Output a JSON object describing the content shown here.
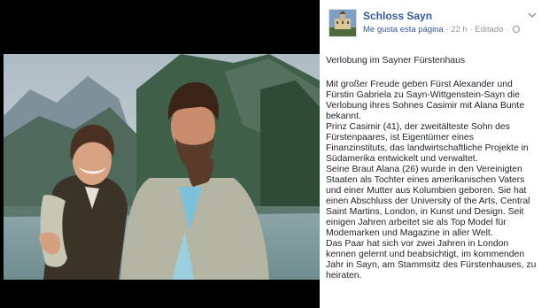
{
  "page": {
    "name": "Schloss Sayn",
    "like_label": "Me gusta esta página",
    "separator": "·",
    "time": "22 h",
    "edited": "Editado"
  },
  "post": {
    "title": "Verlobung im Sayner Fürstenhaus",
    "lines": [
      "Mit großer Freude geben Fürst Alexander und",
      "Fürstin Gabriela zu Sayn-Wittgenstein-Sayn die",
      "Verlobung ihres Sohnes Casimir mit Alana Bunte",
      "bekannt.",
      "Prinz Casimir (41), der zweitälteste Sohn des",
      "Fürstenpaares, ist Eigentümer eines",
      "Finanzinstituts, das landwirtschaftliche Projekte in",
      "Südamerika entwickelt und verwaltet.",
      "Seine Braut Alana (26) wurde in den Vereinigten",
      "Staaten als Tochter eines amerikanischen Vaters",
      "und einer Mutter aus Kolumbien geboren. Sie hat",
      "einen Abschluss der University of the Arts, Central",
      "Saint Martins, London, in Kunst und Design. Seit",
      "einigen Jahren arbeitet sie als Top Model für",
      "Modemarken und Magazine in aller Welt.",
      "Das Paar hat sich vor zwei Jahren in London",
      "kennen gelernt und beabsichtigt, im kommenden",
      "Jahr in Sayn, am Stammsitz des Fürstenhauses, zu",
      "heiraten."
    ]
  },
  "icons": {
    "options": "chevron-down-icon",
    "privacy": "globe-icon"
  },
  "colors": {
    "link": "#365899",
    "meta": "#90949c",
    "text": "#1d2129",
    "background": "#000000"
  }
}
